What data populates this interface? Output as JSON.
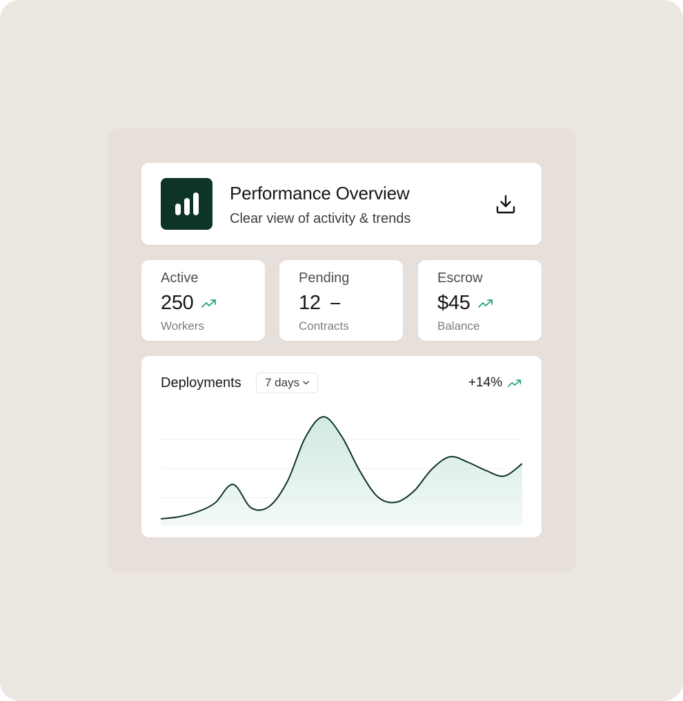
{
  "header": {
    "title": "Performance Overview",
    "subtitle": "Clear view of activity & trends",
    "logo_icon": "bar-chart-icon",
    "download_icon": "download-icon"
  },
  "stats": [
    {
      "label": "Active",
      "value": "250",
      "sub": "Workers",
      "trend": "up"
    },
    {
      "label": "Pending",
      "value": "12",
      "sub": "Contracts",
      "trend": "flat"
    },
    {
      "label": "Escrow",
      "value": "$45",
      "sub": "Balance",
      "trend": "up"
    }
  ],
  "deployments": {
    "title": "Deployments",
    "range_selected": "7 days",
    "change": "+14%"
  },
  "chart_data": {
    "type": "area",
    "title": "Deployments",
    "x": [
      0,
      1,
      2,
      3,
      4,
      5,
      6,
      7,
      8,
      9,
      10,
      11,
      12,
      13,
      14,
      15,
      16,
      17,
      18,
      19,
      20
    ],
    "values": [
      10,
      13,
      20,
      33,
      60,
      26,
      28,
      64,
      128,
      158,
      130,
      80,
      42,
      34,
      50,
      82,
      100,
      92,
      80,
      72,
      90
    ],
    "ylim": [
      0,
      170
    ],
    "grid": true,
    "colors": {
      "line": "#0e3327",
      "fill": "#cfe9de",
      "trend": "#1ea57c"
    }
  },
  "colors": {
    "accent": "#0e3327",
    "trend_up": "#1ea57c",
    "background": "#ece7e1",
    "panel": "#e6dfda"
  }
}
